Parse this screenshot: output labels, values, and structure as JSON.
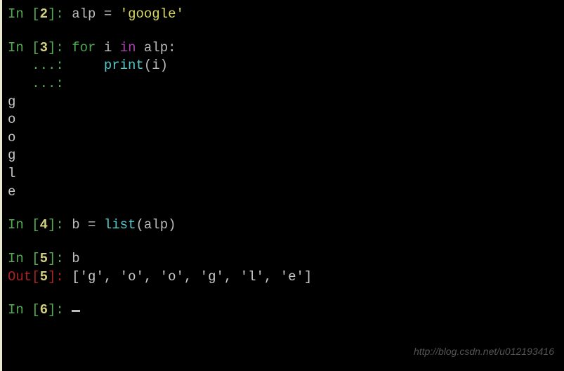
{
  "cells": {
    "c2": {
      "prompt_label": "In ",
      "num": "2",
      "code_var": "alp",
      "code_assign": " = ",
      "code_string": "'google'"
    },
    "c3": {
      "prompt_label": "In ",
      "num": "3",
      "kw_for": "for",
      "var_i": " i ",
      "kw_in": "in",
      "var_alp": " alp",
      "colon": ":",
      "cont1": "   ...: ",
      "indent": "    ",
      "func_print": "print",
      "args": "(i)",
      "cont2": "   ...: ",
      "output": [
        "g",
        "o",
        "o",
        "g",
        "l",
        "e"
      ]
    },
    "c4": {
      "prompt_label": "In ",
      "num": "4",
      "var_b": "b",
      "assign": " = ",
      "func_list": "list",
      "args": "(alp)"
    },
    "c5": {
      "prompt_label": "In ",
      "num": "5",
      "expr": "b",
      "out_label": "Out",
      "result": "['g', 'o', 'o', 'g', 'l', 'e']"
    },
    "c6": {
      "prompt_label": "In ",
      "num": "6"
    }
  },
  "watermark": "http://blog.csdn.net/u012193416"
}
